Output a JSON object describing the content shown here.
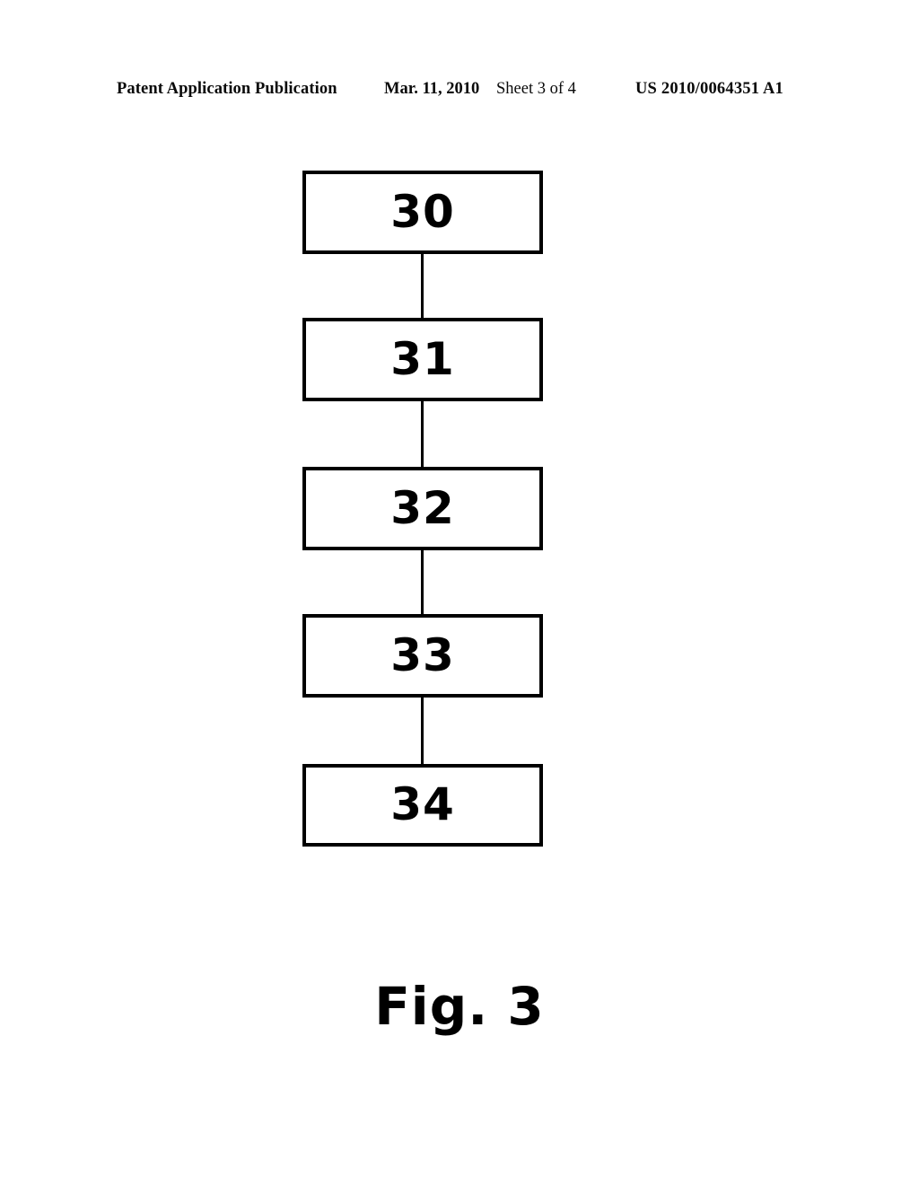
{
  "header": {
    "publication_label": "Patent Application Publication",
    "date": "Mar. 11, 2010",
    "sheet": "Sheet 3 of 4",
    "publication_number": "US 2010/0064351 A1"
  },
  "figure": {
    "caption": "Fig. 3",
    "ink_color": "#000000",
    "background_color": "#ffffff",
    "boxes": [
      {
        "label": "30"
      },
      {
        "label": "31"
      },
      {
        "label": "32"
      },
      {
        "label": "33"
      },
      {
        "label": "34"
      }
    ],
    "connectors": [
      {
        "from": "30",
        "to": "31"
      },
      {
        "from": "31",
        "to": "32"
      },
      {
        "from": "32",
        "to": "33"
      },
      {
        "from": "33",
        "to": "34"
      }
    ]
  }
}
